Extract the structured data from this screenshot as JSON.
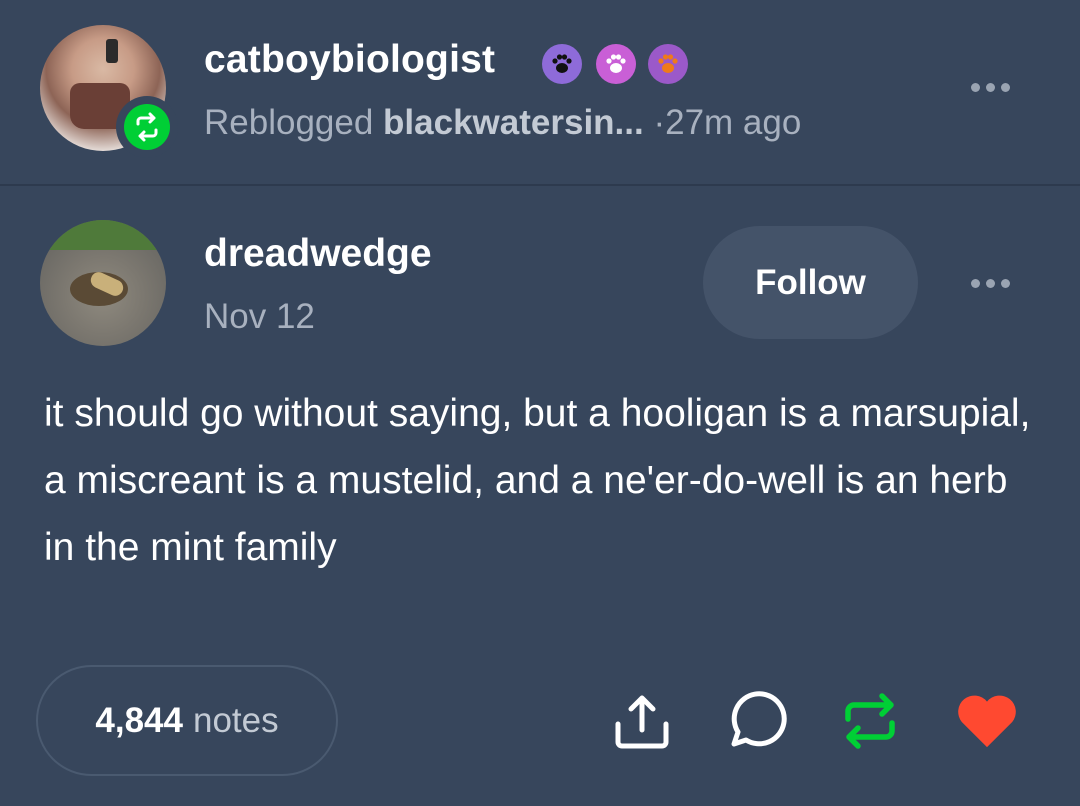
{
  "reblog": {
    "username": "catboybiologist",
    "action_label": "Reblogged",
    "source_username": "blackwatersin...",
    "separator": "·",
    "time_ago": "27m ago"
  },
  "post": {
    "author": "dreadwedge",
    "date": "Nov 12",
    "follow_label": "Follow",
    "body": "it should go without saying, but a hooligan is a marsupial, a miscreant is a mustelid, and a ne'er-do-well is an herb in the mint family"
  },
  "footer": {
    "notes_count": "4,844",
    "notes_label": "notes"
  },
  "icons": {
    "paw_badges": [
      "paw-badge-purple-icon",
      "paw-badge-pink-icon",
      "paw-badge-orange-icon"
    ],
    "actions": [
      "share-icon",
      "reply-icon",
      "reblog-icon",
      "like-icon"
    ]
  },
  "colors": {
    "background": "#37465c",
    "reblog_green": "#00cf35",
    "like_red": "#ff4930",
    "muted_text": "#a8b1bf"
  }
}
